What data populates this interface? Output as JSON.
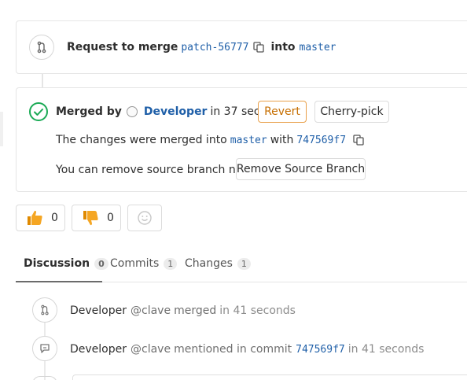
{
  "merge_request": {
    "prefix": "Request to merge",
    "source_branch": "patch-56777",
    "into": "into",
    "target_branch": "master"
  },
  "merged_widget": {
    "merged_by_label": "Merged by",
    "author": "Developer",
    "time": "in 37 seconds",
    "revert_label": "Revert",
    "cherry_pick_label": "Cherry-pick",
    "changes_text": "The changes were merged into",
    "target_branch": "master",
    "with_text": "with",
    "commit_sha": "747569f7",
    "remove_text": "You can remove source branch now",
    "remove_button_label": "Remove Source Branch"
  },
  "awards": {
    "thumbs_up_count": "0",
    "thumbs_down_count": "0"
  },
  "tabs": [
    {
      "label": "Discussion",
      "count": "0"
    },
    {
      "label": "Commits",
      "count": "1"
    },
    {
      "label": "Changes",
      "count": "1"
    }
  ],
  "notes": [
    {
      "author": "Developer",
      "handle": "@clave",
      "action": "merged",
      "time": "in 41 seconds"
    },
    {
      "author": "Developer",
      "handle": "@clave",
      "action": "mentioned in commit",
      "commit": "747569f7",
      "time": "in 41 seconds"
    }
  ],
  "colors": {
    "success": "#1aaa55",
    "link": "#1f5fa8",
    "warning": "#c66e00",
    "thumb": "#f5a623"
  }
}
